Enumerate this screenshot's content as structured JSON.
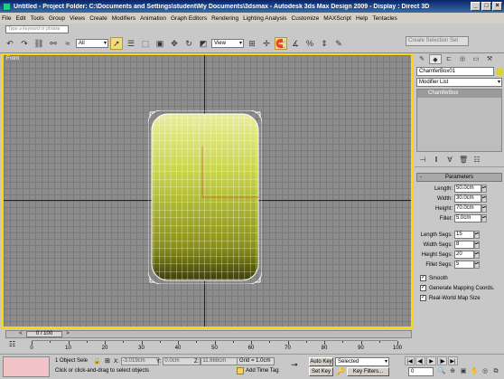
{
  "window": {
    "title": "Untitled    - Project Folder: C:\\Documents and Settings\\student\\My Documents\\3dsmax    - Autodesk 3ds Max Design 2009    - Display : Direct 3D",
    "min": "_",
    "max": "□",
    "close": "×"
  },
  "menu": [
    "File",
    "Edit",
    "Tools",
    "Group",
    "Views",
    "Create",
    "Modifiers",
    "Animation",
    "Graph Editors",
    "Rendering",
    "Lighting Analysis",
    "Customize",
    "MAXScript",
    "Help",
    "Tentacles"
  ],
  "toolbar": {
    "search_placeholder": "Type a keyword or phrase",
    "filter": "All",
    "coord_system": "View",
    "selection_set": "Create Selection Set"
  },
  "viewport": {
    "label": "Front"
  },
  "command_panel": {
    "object_name": "ChamferBox01",
    "modifier_list": "Modifier List",
    "stack_item": "ChamferBox",
    "rollout": "Parameters",
    "params": [
      {
        "label": "Length:",
        "value": "50.0cm"
      },
      {
        "label": "Width:",
        "value": "30.0cm"
      },
      {
        "label": "Height:",
        "value": "70.0cm"
      },
      {
        "label": "Fillet:",
        "value": "5.0cm"
      }
    ],
    "segs": [
      {
        "label": "Length Segs:",
        "value": "15"
      },
      {
        "label": "Width Segs:",
        "value": "8"
      },
      {
        "label": "Height Segs:",
        "value": "20"
      },
      {
        "label": "Fillet Segs:",
        "value": "5"
      }
    ],
    "checks": [
      {
        "label": "Smooth",
        "checked": true
      },
      {
        "label": "Generate Mapping Coords.",
        "checked": true
      },
      {
        "label": "Real-World Map Size",
        "checked": true
      }
    ],
    "object_color": "#d8d13a"
  },
  "timeline": {
    "slider_label": "0 / 100",
    "prev": "<",
    "next": ">",
    "ticks": [
      "0",
      "10",
      "20",
      "30",
      "40",
      "50",
      "60",
      "70",
      "80",
      "90",
      "100"
    ]
  },
  "status": {
    "selected": "1 Object Sele",
    "x_label": "X:",
    "x_value": "-3.019cm",
    "y_label": "Y:",
    "y_value": "0.0cm",
    "z_label": "Z:",
    "z_value": "11.668cm",
    "grid": "Grid = 1.0cm",
    "prompt": "Click or click-and-drag to select objects",
    "add_time_tag": "Add Time Tag",
    "auto_key": "Auto Key",
    "set_key": "Set Key",
    "selected_dropdown": "Selected",
    "key_filters": "Key Filters...",
    "frame": "0"
  }
}
